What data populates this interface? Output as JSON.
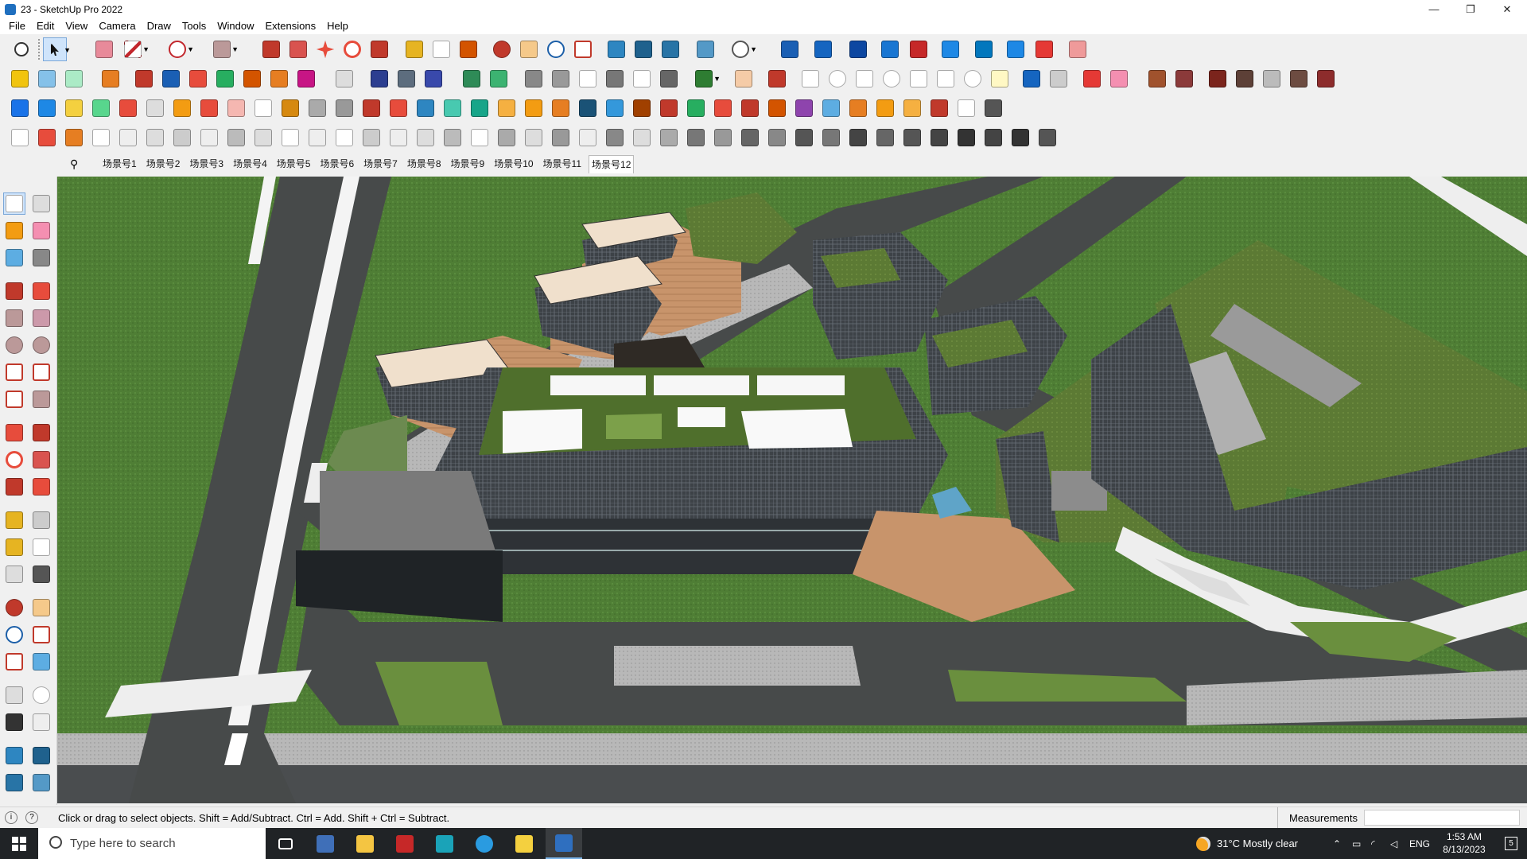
{
  "window": {
    "title": "23 - SketchUp Pro 2022",
    "minimize_glyph": "—",
    "maximize_glyph": "❐",
    "close_glyph": "✕"
  },
  "menu": [
    "File",
    "Edit",
    "View",
    "Camera",
    "Draw",
    "Tools",
    "Window",
    "Extensions",
    "Help"
  ],
  "scenes": {
    "tabs": [
      "场景号1",
      "场景号2",
      "场景号3",
      "场景号4",
      "场景号5",
      "场景号6",
      "场景号7",
      "场景号8",
      "场景号9",
      "场景号10",
      "场景号11",
      "场景号12"
    ],
    "active_index": 11
  },
  "status": {
    "message": "Click or drag to select objects. Shift = Add/Subtract. Ctrl = Add. Shift + Ctrl = Subtract.",
    "measurements_label": "Measurements",
    "measurements_value": ""
  },
  "taskbar": {
    "search_placeholder": "Type here to search",
    "weather_text": "31°C  Mostly clear",
    "language": "ENG",
    "time": "1:53 AM",
    "date": "8/13/2023",
    "notification_count": "5"
  },
  "colors": {
    "accent": "#cfe4fb",
    "lawn": "#4e7d34",
    "road": "#474a4a",
    "glass": "#3b3f45",
    "deck": "#c8946b"
  }
}
